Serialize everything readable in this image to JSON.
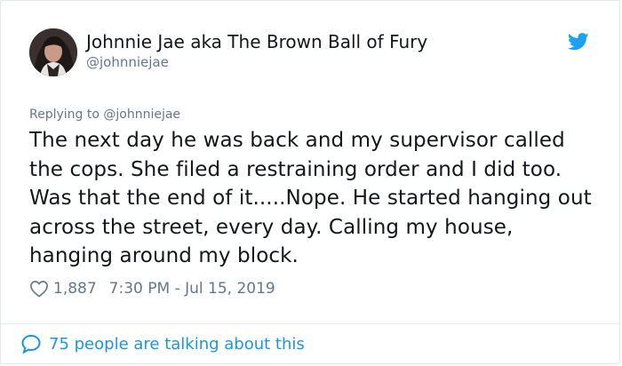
{
  "tweet": {
    "author": {
      "display_name": "Johnnie Jae aka The Brown Ball of Fury",
      "handle": "@johnniejae",
      "avatar_icon": "profile-photo"
    },
    "platform_icon": "twitter-bird-icon",
    "replying_to_prefix": "Replying to",
    "replying_to_handle": "@johnniejae",
    "text": "The next day he was back and my supervisor called the cops. She filed a restraining order and I did too. Was that the end of it.....Nope. He started hanging out across the street, every day. Calling my house, hanging around my block.",
    "likes": "1,887",
    "timestamp": "7:30 PM - Jul 15, 2019",
    "conversation_label": "75 people are talking about this"
  },
  "colors": {
    "accent": "#1b95e0",
    "secondary_text": "#657786",
    "primary_text": "#14171a",
    "border": "#e1e8ed"
  }
}
